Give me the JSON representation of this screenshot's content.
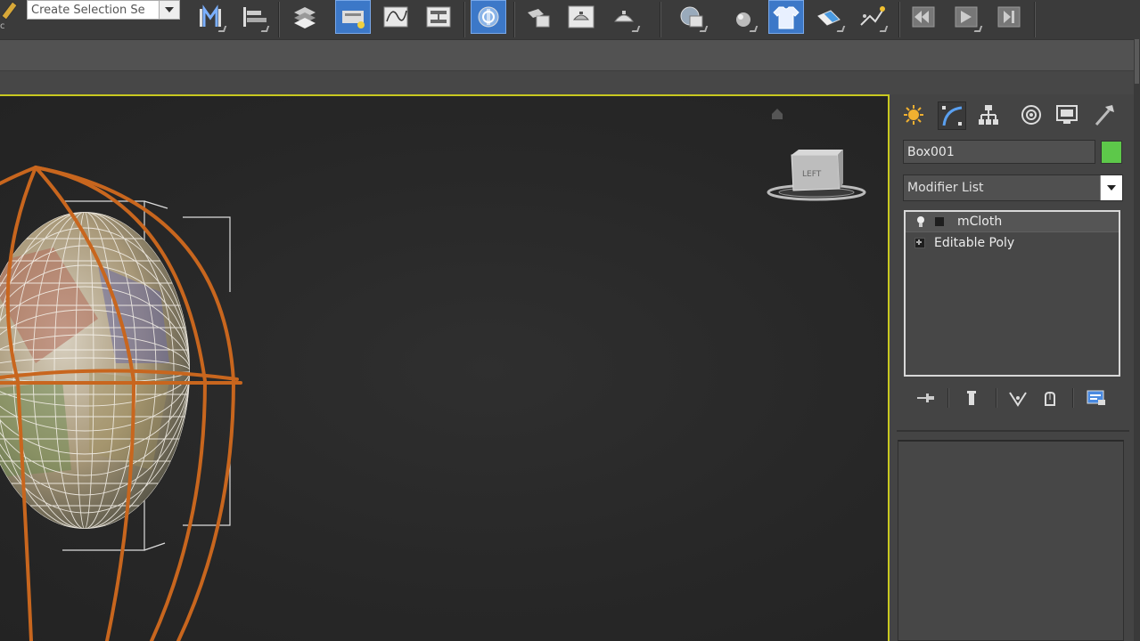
{
  "toolbar": {
    "selection_set_placeholder": "Create Selection Se",
    "buttons": [
      {
        "name": "mirror-icon",
        "active": false
      },
      {
        "name": "align-icon",
        "active": false
      },
      {
        "name": "layer-manager-icon",
        "active": false
      },
      {
        "name": "scene-explorer-icon",
        "active": true
      },
      {
        "name": "curve-editor-icon",
        "active": false
      },
      {
        "name": "schematic-view-icon",
        "active": false
      },
      {
        "name": "material-editor-icon",
        "active": true
      },
      {
        "name": "render-setup-icon",
        "active": false
      },
      {
        "name": "rendered-frame-window-icon",
        "active": false
      },
      {
        "name": "render-production-icon",
        "active": false
      },
      {
        "name": "render-online-icon",
        "active": false
      },
      {
        "name": "sphere-icon",
        "active": false
      },
      {
        "name": "mcloth-shirt-icon",
        "active": true
      },
      {
        "name": "eraser-icon",
        "active": false
      },
      {
        "name": "particle-flow-icon",
        "active": false
      },
      {
        "name": "rewind-icon",
        "active": false
      },
      {
        "name": "play-icon",
        "active": false
      },
      {
        "name": "end-icon",
        "active": false
      }
    ]
  },
  "viewport": {
    "viewcube_label": "LEFT"
  },
  "command_panel": {
    "tabs": [
      "create-tab",
      "modify-tab",
      "hierarchy-tab",
      "motion-tab",
      "display-tab",
      "utilities-tab"
    ],
    "object_name": "Box001",
    "object_color": "#5dc84a",
    "modifier_list_label": "Modifier List",
    "stack": [
      {
        "label": "mCloth",
        "selected": true
      },
      {
        "label": "Editable Poly",
        "selected": false
      }
    ]
  },
  "colors": {
    "viewport_border_active": "#c8c820",
    "active_button": "#3c78c8",
    "wire_orange": "#c8661e"
  }
}
